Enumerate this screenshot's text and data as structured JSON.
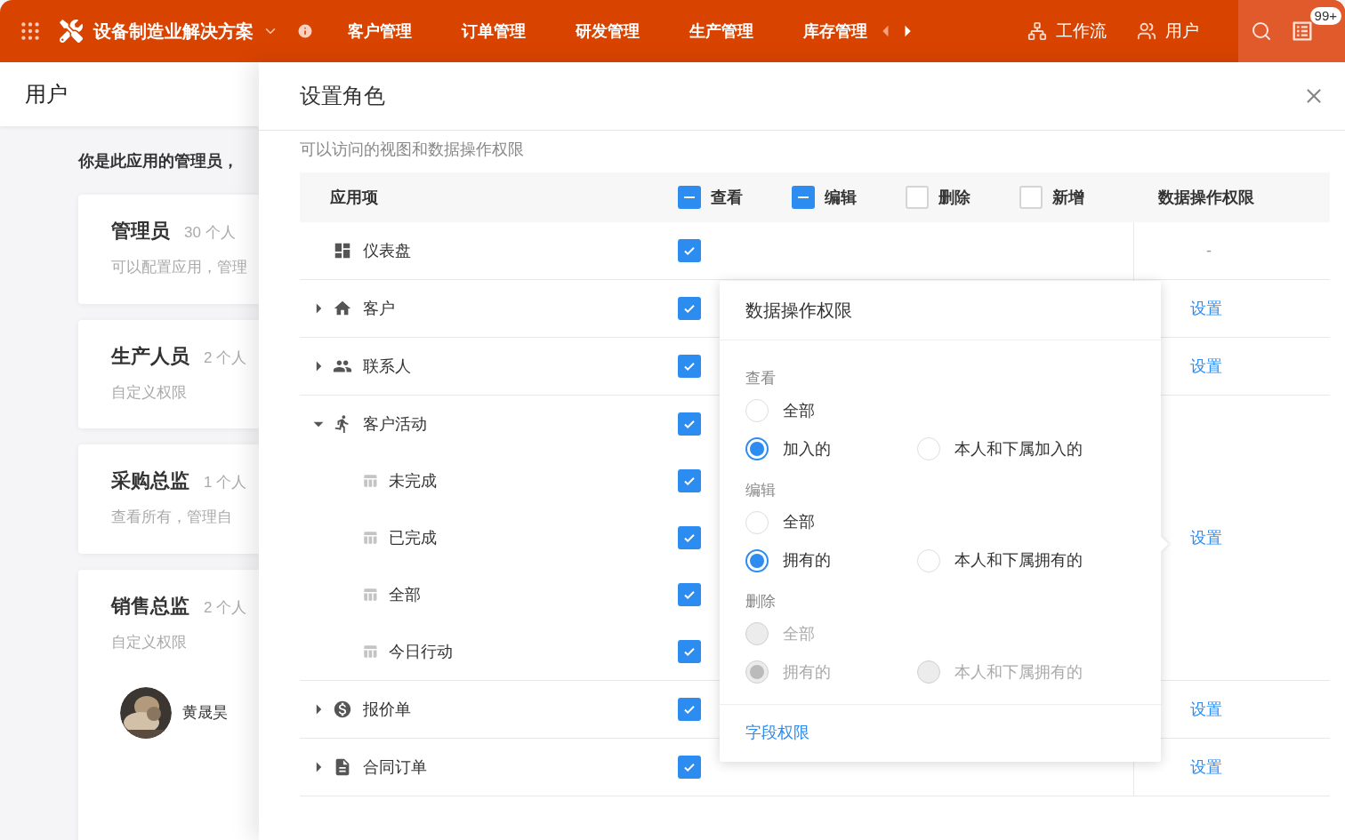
{
  "topbar": {
    "app_title": "设备制造业解决方案",
    "nav": [
      {
        "label": "客户管理"
      },
      {
        "label": "订单管理"
      },
      {
        "label": "研发管理"
      },
      {
        "label": "生产管理"
      },
      {
        "label": "库存管理"
      }
    ],
    "prev_disabled": true,
    "next_disabled": false,
    "actions": [
      {
        "kind": "workflow",
        "label": "工作流"
      },
      {
        "kind": "users",
        "label": "用户"
      }
    ],
    "badge": "99+"
  },
  "users_panel": {
    "title": "用户",
    "notice": "你是此应用的管理员，",
    "roles": [
      {
        "name": "管理员",
        "count": "30 个人",
        "desc": "可以配置应用，管理"
      },
      {
        "name": "生产人员",
        "count": "2 个人",
        "desc": "自定义权限"
      },
      {
        "name": "采购总监",
        "count": "1 个人",
        "desc": "查看所有，管理自"
      },
      {
        "name": "销售总监",
        "count": "2 个人",
        "desc": "自定义权限",
        "members": [
          {
            "name": "黄晟昊"
          }
        ]
      }
    ]
  },
  "drawer": {
    "title": "设置角色",
    "subtitle": "可以访问的视图和数据操作权限",
    "table": {
      "columns": [
        {
          "kind": "label",
          "label": "应用项"
        },
        {
          "kind": "check",
          "label": "查看",
          "indeterminate": true
        },
        {
          "kind": "check",
          "label": "编辑",
          "indeterminate": true
        },
        {
          "kind": "check",
          "label": "删除",
          "indeterminate": false
        },
        {
          "kind": "check",
          "label": "新增",
          "indeterminate": false
        },
        {
          "kind": "label",
          "label": "数据操作权限"
        }
      ],
      "rows": [
        {
          "kind": "dashboard",
          "label": "仪表盘",
          "expanded": null,
          "checked": true,
          "permission": "-"
        },
        {
          "kind": "home",
          "label": "客户",
          "expanded": false,
          "checked": true,
          "permission": "设置"
        },
        {
          "kind": "people",
          "label": "联系人",
          "expanded": false,
          "checked": true,
          "permission": "设置"
        },
        {
          "kind": "activity",
          "label": "客户活动",
          "expanded": true,
          "checked": true,
          "permission": "设置",
          "children": [
            {
              "kind": "view",
              "label": "未完成",
              "checked": true
            },
            {
              "kind": "view",
              "label": "已完成",
              "checked": true
            },
            {
              "kind": "view",
              "label": "全部",
              "checked": true
            },
            {
              "kind": "view",
              "label": "今日行动",
              "checked": true
            }
          ]
        },
        {
          "kind": "quote",
          "label": "报价单",
          "expanded": false,
          "checked": true,
          "permission": "设置"
        },
        {
          "kind": "contract",
          "label": "合同订单",
          "expanded": false,
          "checked": true,
          "permission": "设置"
        }
      ]
    }
  },
  "popover": {
    "title": "数据操作权限",
    "sections": [
      {
        "title": "查看",
        "disabled": false,
        "options": [
          {
            "label": "全部",
            "selected": false
          },
          {
            "label": "加入的",
            "selected": true
          },
          {
            "label": "本人和下属加入的",
            "selected": false
          }
        ]
      },
      {
        "title": "编辑",
        "disabled": false,
        "options": [
          {
            "label": "全部",
            "selected": false
          },
          {
            "label": "拥有的",
            "selected": true
          },
          {
            "label": "本人和下属拥有的",
            "selected": false
          }
        ]
      },
      {
        "title": "删除",
        "disabled": true,
        "options": [
          {
            "label": "全部",
            "selected": false
          },
          {
            "label": "拥有的",
            "selected": true
          },
          {
            "label": "本人和下属拥有的",
            "selected": false
          }
        ]
      }
    ],
    "link": "字段权限"
  }
}
